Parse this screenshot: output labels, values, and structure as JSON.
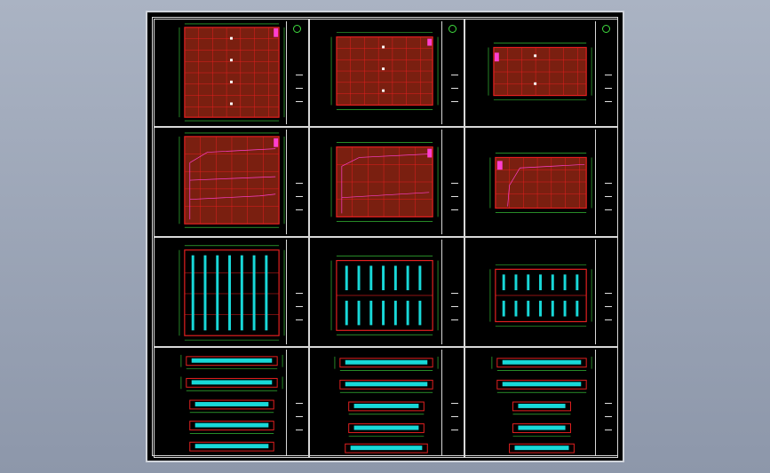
{
  "colors": {
    "background": "#99a2b4",
    "sheet": "#000000",
    "frame": "#d8d8d8",
    "dimension": "#3fdc3f",
    "structure": "#e52020",
    "fill": "#7a1f10",
    "accent": "#ff3fd0",
    "window": "#18d8d8",
    "text": "#ffffff"
  },
  "sheets": [
    {
      "id": "s1",
      "kind": "floor-plan",
      "icon": "north-arrow-icon"
    },
    {
      "id": "s2",
      "kind": "floor-plan",
      "icon": "north-arrow-icon"
    },
    {
      "id": "s3",
      "kind": "floor-plan",
      "icon": "north-arrow-icon"
    },
    {
      "id": "s4",
      "kind": "site-plan"
    },
    {
      "id": "s5",
      "kind": "site-plan"
    },
    {
      "id": "s6",
      "kind": "site-plan"
    },
    {
      "id": "s7",
      "kind": "roof-plan"
    },
    {
      "id": "s8",
      "kind": "roof-plan"
    },
    {
      "id": "s9",
      "kind": "roof-plan"
    },
    {
      "id": "s10",
      "kind": "elevations"
    },
    {
      "id": "s11",
      "kind": "elevations"
    },
    {
      "id": "s12",
      "kind": "elevations"
    }
  ]
}
